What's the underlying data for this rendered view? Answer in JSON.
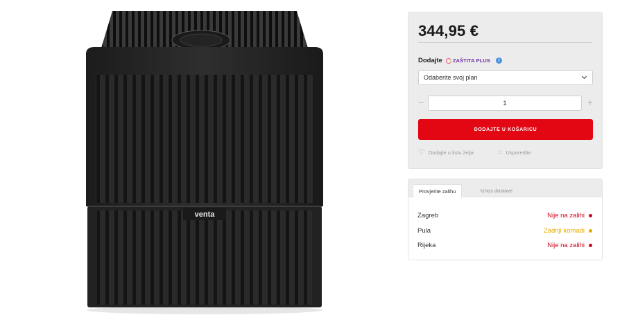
{
  "product": {
    "price": "344,95 €",
    "brand_label": "venta",
    "image_icon": "venta-air-humidifier-image"
  },
  "protection": {
    "label": "Dodajte",
    "brand": "ZAŠTITA PLUS",
    "info_icon": "info-icon",
    "select_value": "Odaberite svoj plan"
  },
  "quantity": {
    "minus": "−",
    "value": "1",
    "plus": "+"
  },
  "actions": {
    "add_to_cart": "DODAJTE U KOŠARICU",
    "wishlist": "Dodajte u listu želja",
    "compare": "Usporedite"
  },
  "stock": {
    "tabs": [
      "Provjerite zalihu",
      "Iznos dostave"
    ],
    "rows": [
      {
        "city": "Zagreb",
        "status": "Nije na zalihi",
        "color": "#d0021b"
      },
      {
        "city": "Pula",
        "status": "Zadnji komadi",
        "color": "#e8a900"
      },
      {
        "city": "Rijeka",
        "status": "Nije na zalihi",
        "color": "#d0021b"
      }
    ]
  },
  "colors": {
    "accent": "#e30613",
    "panel_bg": "#ececec"
  }
}
